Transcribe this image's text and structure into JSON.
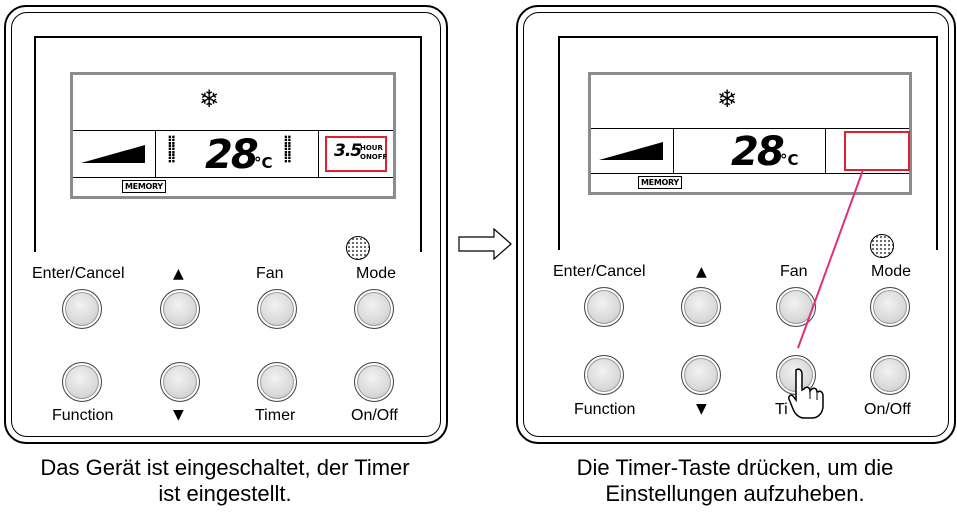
{
  "left_panel": {
    "lcd": {
      "mode_icon": "snowflake-icon",
      "temperature": "28",
      "temperature_unit": "°C",
      "timer": {
        "value": "3.5",
        "hour_label": "HOUR",
        "onoff_label": "ONOFF"
      },
      "memory_label": "MEMORY"
    },
    "buttons": {
      "enter": "Enter/",
      "cancel": "Cancel",
      "fan": "Fan",
      "mode": "Mode",
      "function": "Function",
      "timer": "Timer",
      "onoff": "On/Off"
    },
    "caption": "Das Gerät ist eingeschaltet, der Timer ist eingestellt."
  },
  "right_panel": {
    "lcd": {
      "mode_icon": "snowflake-icon",
      "temperature": "28",
      "temperature_unit": "°C",
      "memory_label": "MEMORY"
    },
    "buttons": {
      "enter": "Enter/",
      "cancel": "Cancel",
      "fan": "Fan",
      "mode": "Mode",
      "function": "Function",
      "timer": "Ti",
      "onoff": "On/Off"
    },
    "caption": "Die Timer-Taste drücken, um die Einstellungen aufzuheben."
  },
  "icons": {
    "transition": "right-arrow-icon",
    "press": "pointing-hand-icon",
    "up": "triangle-up-icon",
    "down": "triangle-down-icon"
  },
  "colors": {
    "highlight": "#e02030",
    "leader_line": "#e0307a",
    "lcd_frame": "#8c8c8c"
  }
}
